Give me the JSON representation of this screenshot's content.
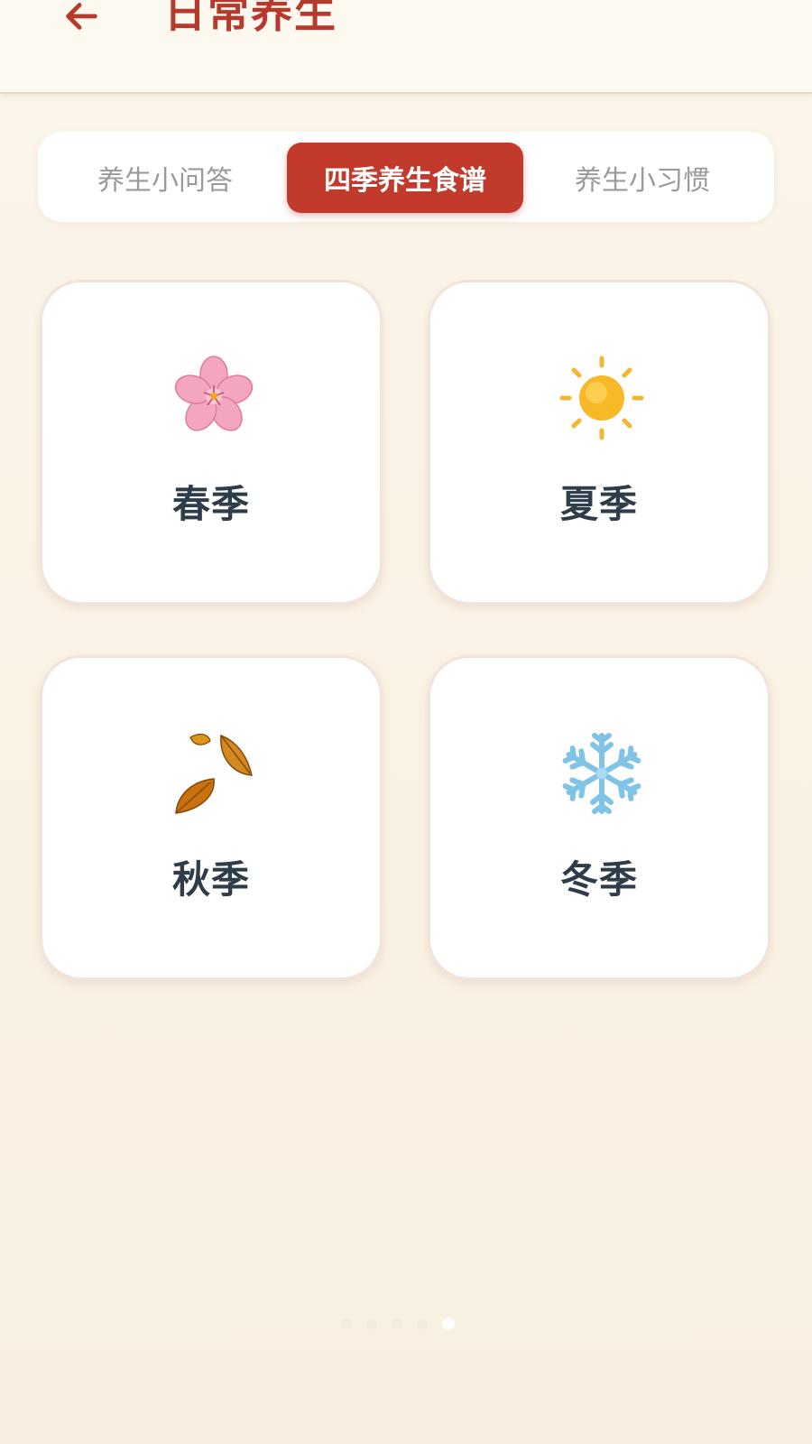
{
  "header": {
    "title": "日常养生",
    "back_icon": "arrow-left-icon"
  },
  "tabs": [
    {
      "label": "养生小问答",
      "active": false
    },
    {
      "label": "四季养生食谱",
      "active": true
    },
    {
      "label": "养生小习惯",
      "active": false
    }
  ],
  "seasons": [
    {
      "label": "春季",
      "icon": "cherry-blossom-icon"
    },
    {
      "label": "夏季",
      "icon": "sun-icon"
    },
    {
      "label": "秋季",
      "icon": "fallen-leaves-icon"
    },
    {
      "label": "冬季",
      "icon": "snowflake-icon"
    }
  ],
  "pager": {
    "count": 5,
    "active_index": 4
  },
  "colors": {
    "accent": "#c23a2b",
    "title": "#b63a2b",
    "background": "#f8f1e3",
    "card_text": "#2f3c4a",
    "tab_inactive_text": "#9a9a9a"
  }
}
